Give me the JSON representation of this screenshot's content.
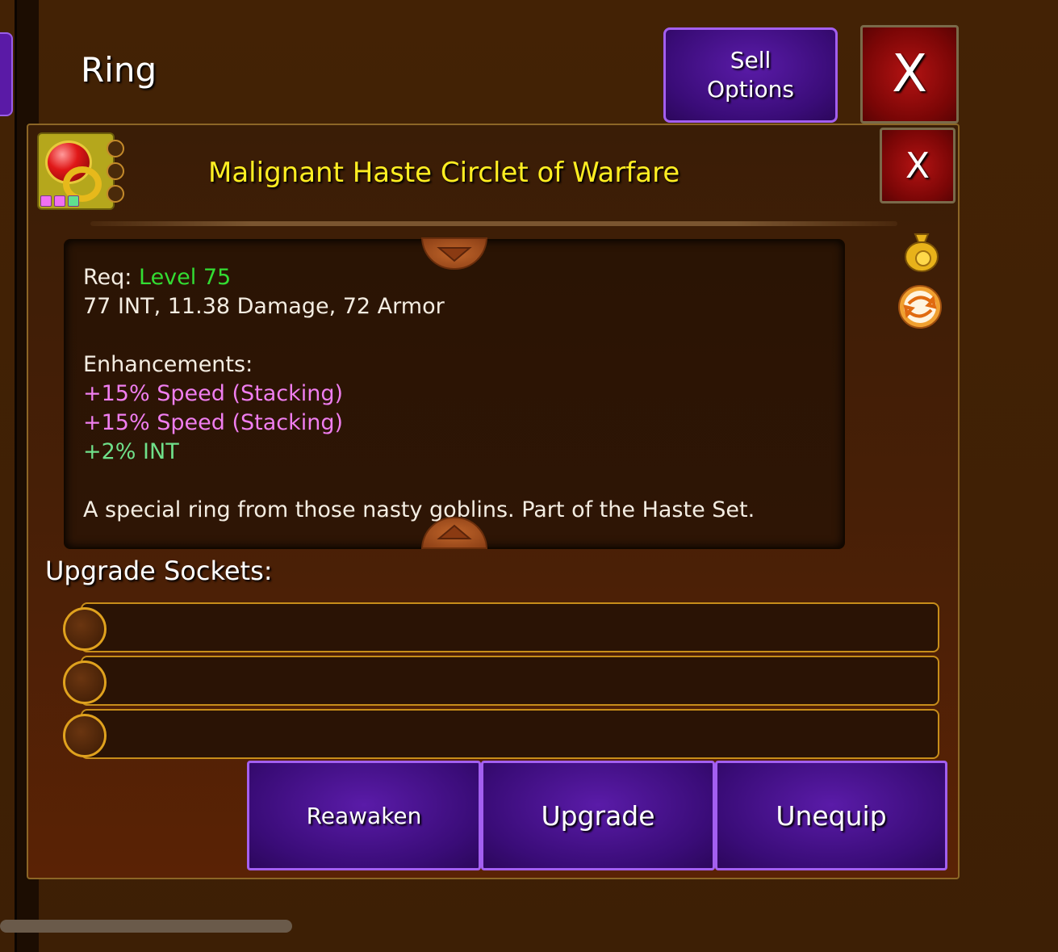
{
  "header": {
    "title": "Ring",
    "sell_options_label_line1": "Sell",
    "sell_options_label_line2": "Options",
    "close_label": "X"
  },
  "item": {
    "name": "Malignant Haste Circlet of Warfare",
    "close_label": "X",
    "socket_dots": [
      "#f070f0",
      "#f070f0",
      "#60e090"
    ],
    "req_prefix": "Req:",
    "req_level": "Level 75",
    "stats": "77 INT, 11.38 Damage, 72 Armor",
    "enhancements_label": "Enhancements:",
    "enhancements": [
      {
        "text": "+15% Speed (Stacking)",
        "color": "#f07ef0"
      },
      {
        "text": "+15% Speed (Stacking)",
        "color": "#f07ef0"
      },
      {
        "text": "+2% INT",
        "color": "#6fe08a"
      }
    ],
    "description": "A special ring from those nasty goblins. Part of the Haste Set."
  },
  "colors": {
    "item_name": "#ffee22",
    "req_level": "#33dd33",
    "purple_button": "#4a128f",
    "red_button": "#a01010"
  },
  "sockets": {
    "label": "Upgrade Sockets:",
    "slots": [
      "",
      "",
      ""
    ]
  },
  "actions": {
    "reawaken": "Reawaken",
    "upgrade": "Upgrade",
    "unequip": "Unequip"
  }
}
